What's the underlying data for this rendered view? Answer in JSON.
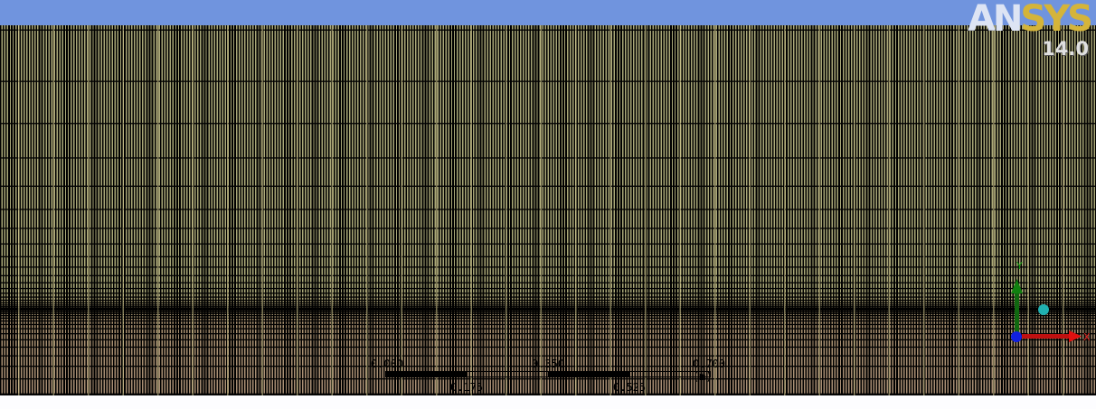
{
  "logo": {
    "brand_part1": "AN",
    "brand_part2": "SYS",
    "version": "14.0"
  },
  "scale_bar": {
    "top_labels": [
      "0.000",
      "0.350",
      "0.700 (m)"
    ],
    "bottom_labels": [
      "0.175",
      "0.525"
    ]
  },
  "triad": {
    "x_label": "X",
    "y_label": "Y"
  },
  "colors": {
    "background": "#7094de",
    "mesh_upper": "#aaa878",
    "mesh_lower": "#a88e74",
    "mesh_lines": "#000000",
    "x_axis": "#e01010",
    "y_axis": "#108010",
    "z_axis": "#1020e0",
    "iso_ball": "#20b0b0"
  }
}
